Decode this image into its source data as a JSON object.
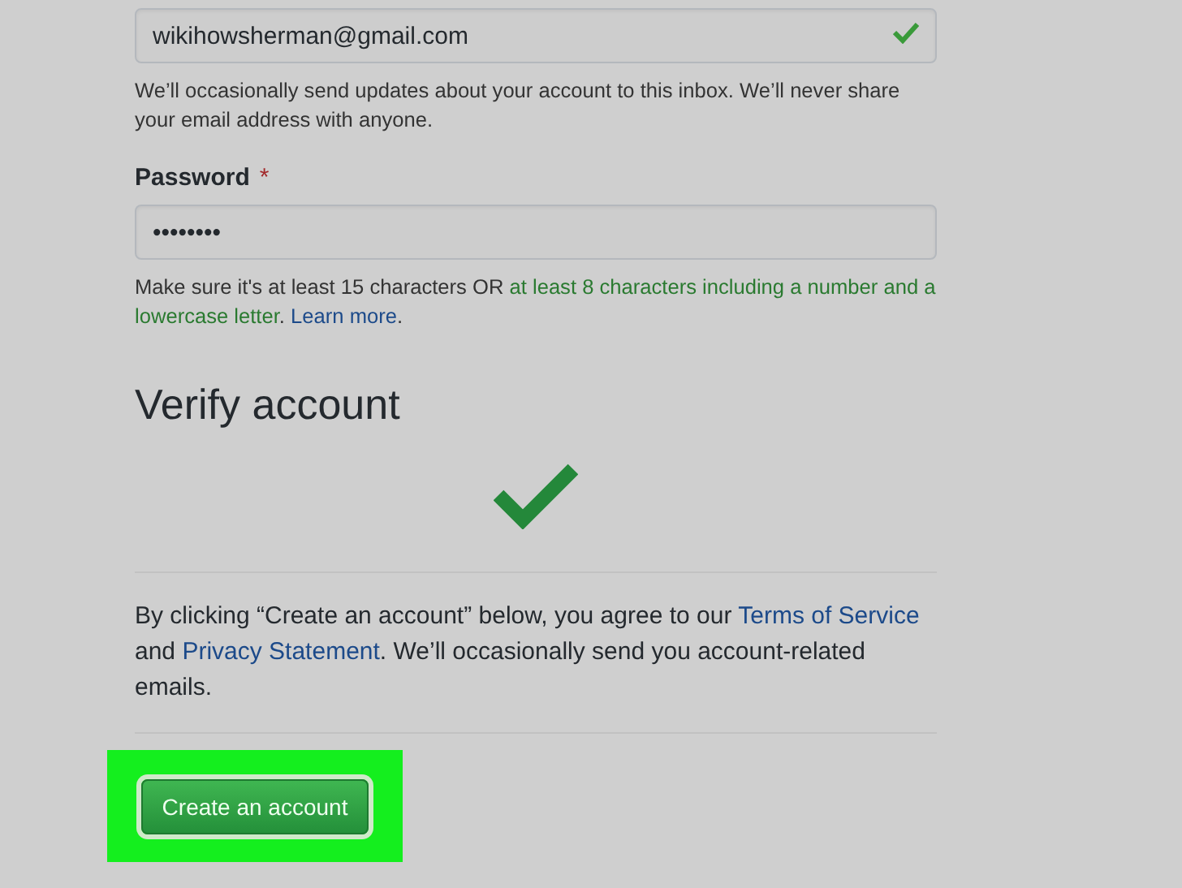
{
  "email": {
    "value": "wikihowsherman@gmail.com",
    "valid": true
  },
  "email_hint": "We’ll occasionally send updates about your account to this inbox. We’ll never share your email address with anyone.",
  "password": {
    "label": "Password",
    "required_mark": "*",
    "value": "••••••••"
  },
  "password_hint": [
    {
      "kind": "plain",
      "text": "Make sure it's at least 15 characters OR "
    },
    {
      "kind": "met",
      "text": "at least 8 characters including a number and a lowercase letter"
    },
    {
      "kind": "plain",
      "text": ". "
    },
    {
      "kind": "link",
      "text": "Learn more"
    },
    {
      "kind": "plain",
      "text": "."
    }
  ],
  "verify": {
    "title": "Verify account",
    "verified": true
  },
  "terms": [
    {
      "kind": "plain",
      "text": "By clicking “Create an account” below, you agree to our "
    },
    {
      "kind": "link",
      "text": "Terms of Service"
    },
    {
      "kind": "plain",
      "text": " and "
    },
    {
      "kind": "link",
      "text": "Privacy Statement"
    },
    {
      "kind": "plain",
      "text": ". We’ll occasionally send you account-related emails."
    }
  ],
  "submit": {
    "label": "Create an account",
    "highlighted": true
  }
}
